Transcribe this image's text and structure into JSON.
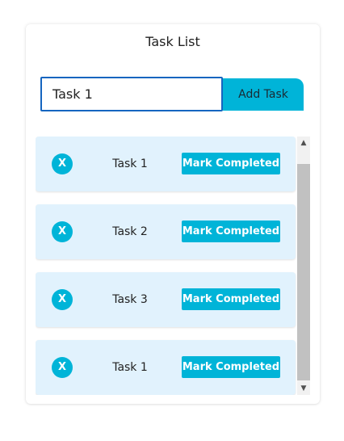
{
  "app": {
    "title": "Task List"
  },
  "form": {
    "input_value": "Task 1",
    "add_label": "Add Task"
  },
  "tasks": [
    {
      "delete_label": "X",
      "name": "Task 1",
      "complete_label": "Mark Completed"
    },
    {
      "delete_label": "X",
      "name": "Task 2",
      "complete_label": "Mark Completed"
    },
    {
      "delete_label": "X",
      "name": "Task 3",
      "complete_label": "Mark Completed"
    },
    {
      "delete_label": "X",
      "name": "Task 1",
      "complete_label": "Mark Completed"
    }
  ],
  "scrollbar": {
    "up_icon": "chevron-up-icon",
    "down_icon": "chevron-down-icon"
  },
  "colors": {
    "accent": "#00b4d8",
    "item_background": "#e1f2fd",
    "input_border": "#1565c0"
  }
}
